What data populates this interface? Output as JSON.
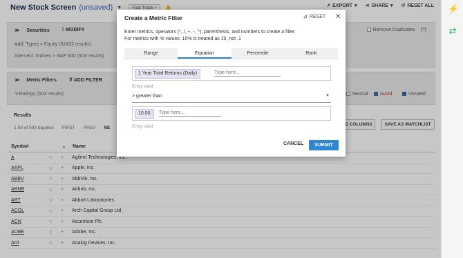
{
  "header": {
    "title": "New Stock Screen",
    "unsaved": "(unsaved)",
    "fast_track": "Fast Track",
    "export": "EXPORT",
    "share": "SHARE",
    "reset_all": "RESET ALL"
  },
  "securities": {
    "label": "Securities",
    "modify": "MODIFY",
    "add_line": "Add: Types > Equity (32432 results)",
    "intersect_line": "Intersect: Indices > S&P 500 (503 results)",
    "remove_duplicates": "Remove Duplicates"
  },
  "metric_filters": {
    "label": "Metric Filters",
    "add_filter": "ADD FILTER",
    "y_ratings": "Y-Ratings (503 results)",
    "neutral": "Neutral",
    "avoid": "Avoid",
    "unrated": "Unrated"
  },
  "results": {
    "label": "Results",
    "count": "1-50 of 503 Equities",
    "first": "FIRST",
    "prev": "PREV",
    "next_partial": "NE",
    "columns_btn": "O COLUMNS",
    "save_watchlist": "SAVE AS WATCHLIST"
  },
  "table": {
    "col_symbol": "Symbol",
    "col_name": "Name",
    "rows": [
      {
        "symbol": "A",
        "name": "Agilent Technologies, Inc."
      },
      {
        "symbol": "AAPL",
        "name": "Apple, Inc."
      },
      {
        "symbol": "ABBV",
        "name": "AbbVie, Inc."
      },
      {
        "symbol": "ABNB",
        "name": "Airbnb, Inc."
      },
      {
        "symbol": "ABT",
        "name": "Abbott Laboratories"
      },
      {
        "symbol": "ACGL",
        "name": "Arch Capital Group Ltd."
      },
      {
        "symbol": "ACN",
        "name": "Accenture Plc"
      },
      {
        "symbol": "ADBE",
        "name": "Adobe, Inc."
      },
      {
        "symbol": "ADI",
        "name": "Analog Devices, Inc."
      }
    ]
  },
  "modal": {
    "title": "Create a Metric Filter",
    "reset": "RESET",
    "desc_line1": "Enter metrics, operators (*, /, +, -, ^), parenthesis, and numbers to create a filter.",
    "desc_line2": "For metrics with % values: 10% is treated as 10, not .1",
    "tabs": [
      "Range",
      "Equation",
      "Percentile",
      "Rank"
    ],
    "metric_chip": "1 Year Total Returns (Daily)",
    "placeholder": "Type here...",
    "entry_valid": "Entry valid",
    "operator": "> greater than",
    "value_chip": "10.00",
    "cancel": "CANCEL",
    "submit": "SUBMIT"
  }
}
